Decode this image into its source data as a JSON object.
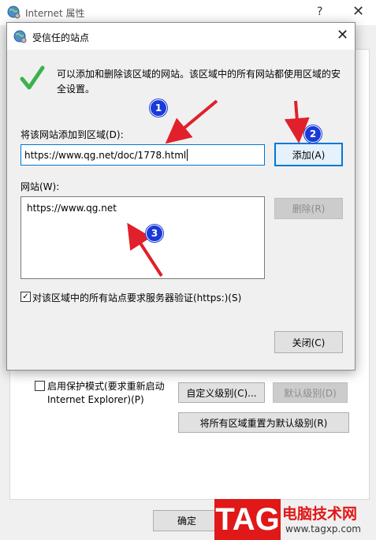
{
  "background_window": {
    "title": "Internet 属性",
    "help": "?",
    "close": "✕",
    "protected_mode_line1": "启用保护模式(要求重新启动",
    "protected_mode_line2": "Internet Explorer)(P)",
    "custom_level": "自定义级别(C)...",
    "default_level": "默认级别(D)",
    "reset_all": "将所有区域重置为默认级别(R)",
    "ok": "确定"
  },
  "dialog": {
    "title": "受信任的站点",
    "close": "✕",
    "info": "可以添加和删除该区域的网站。该区域中的所有网站都使用区域的安全设置。",
    "add_label": "将该网站添加到区域(D):",
    "url_value": "https://www.qg.net/doc/1778.html",
    "add_button": "添加(A)",
    "sites_label": "网站(W):",
    "sites": [
      "https://www.qg.net"
    ],
    "remove_button": "删除(R)",
    "require_verification": "对该区域中的所有站点要求服务器验证(https:)(S)",
    "require_verification_checked": true,
    "close_button": "关闭(C)"
  },
  "annotations": {
    "badges": [
      "1",
      "2",
      "3"
    ],
    "color_arrow": "#e0202a",
    "color_badge": "#1a3ad8"
  },
  "watermark": {
    "logo": "TAG",
    "site_name": "电脑技术网",
    "url": "www.tagxp.com"
  }
}
